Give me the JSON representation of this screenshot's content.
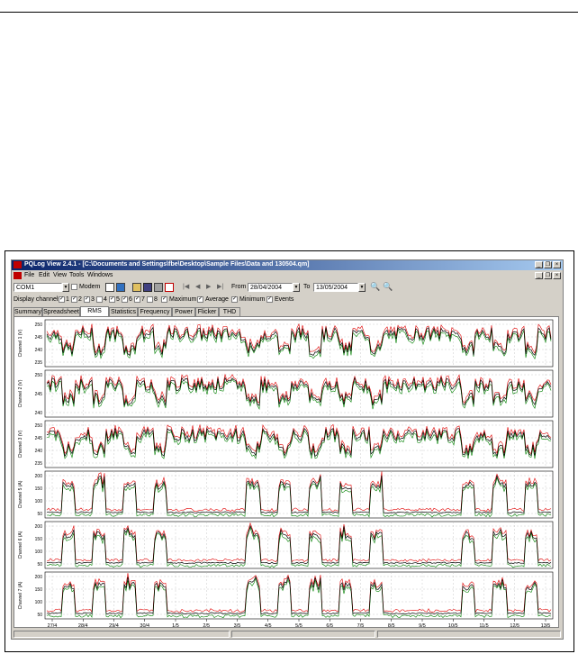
{
  "window": {
    "title": "PQLog View 2.4.1 - [C:\\Documents and Settings\\fbe\\Desktop\\Sample Files\\Data and 130504.qm]"
  },
  "menu": [
    "File",
    "Edit",
    "View",
    "Tools",
    "Windows"
  ],
  "toolbar": {
    "port_value": "COM1",
    "modem_label": "Modem",
    "from_label": "From",
    "from_value": "28/04/2004",
    "to_label": "To",
    "to_value": "13/05/2004"
  },
  "options": {
    "display_channels_label": "Display channels",
    "channels": [
      {
        "label": "1",
        "checked": true
      },
      {
        "label": "2",
        "checked": true
      },
      {
        "label": "3",
        "checked": true
      },
      {
        "label": "4",
        "checked": false
      },
      {
        "label": "5",
        "checked": true
      },
      {
        "label": "6",
        "checked": true
      },
      {
        "label": "7",
        "checked": true
      },
      {
        "label": "8",
        "checked": false
      }
    ],
    "maximum_label": "Maximum",
    "average_label": "Average",
    "minimum_label": "Minimum",
    "events_label": "Events"
  },
  "tabs": [
    {
      "label": "Summary",
      "active": false
    },
    {
      "label": "Spreadsheet",
      "active": false
    },
    {
      "label": "RMS",
      "active": true
    },
    {
      "label": "Statistics",
      "active": false
    },
    {
      "label": "Frequency",
      "active": false
    },
    {
      "label": "Power",
      "active": false
    },
    {
      "label": "Flicker",
      "active": false
    },
    {
      "label": "THD",
      "active": false
    }
  ],
  "colors": {
    "maximum": "#e00000",
    "average": "#000000",
    "minimum": "#008000"
  },
  "chart_data": {
    "type": "line",
    "x_ticks": [
      "27/4",
      "28/4",
      "29/4",
      "30/4",
      "1/5",
      "2/5",
      "3/5",
      "4/5",
      "5/5",
      "6/5",
      "7/5",
      "8/5",
      "9/5",
      "10/5",
      "11/5",
      "12/5",
      "13/5"
    ],
    "grid": true,
    "panels": [
      {
        "ylabel": "Channel 1 (V)",
        "yticks": [
          "250",
          "245",
          "240",
          "235"
        ],
        "kind": "voltage"
      },
      {
        "ylabel": "Channel 2 (V)",
        "yticks": [
          "250",
          "245",
          "240"
        ],
        "kind": "voltage"
      },
      {
        "ylabel": "Channel 3 (V)",
        "yticks": [
          "250",
          "245",
          "240",
          "235"
        ],
        "kind": "voltage"
      },
      {
        "ylabel": "Channel 5 (A)",
        "yticks": [
          "200",
          "150",
          "100",
          "50"
        ],
        "kind": "current"
      },
      {
        "ylabel": "Channel 6 (A)",
        "yticks": [
          "200",
          "150",
          "100",
          "50"
        ],
        "kind": "current"
      },
      {
        "ylabel": "Channel 7 (A)",
        "yticks": [
          "200",
          "150",
          "100",
          "50"
        ],
        "kind": "current"
      }
    ]
  }
}
